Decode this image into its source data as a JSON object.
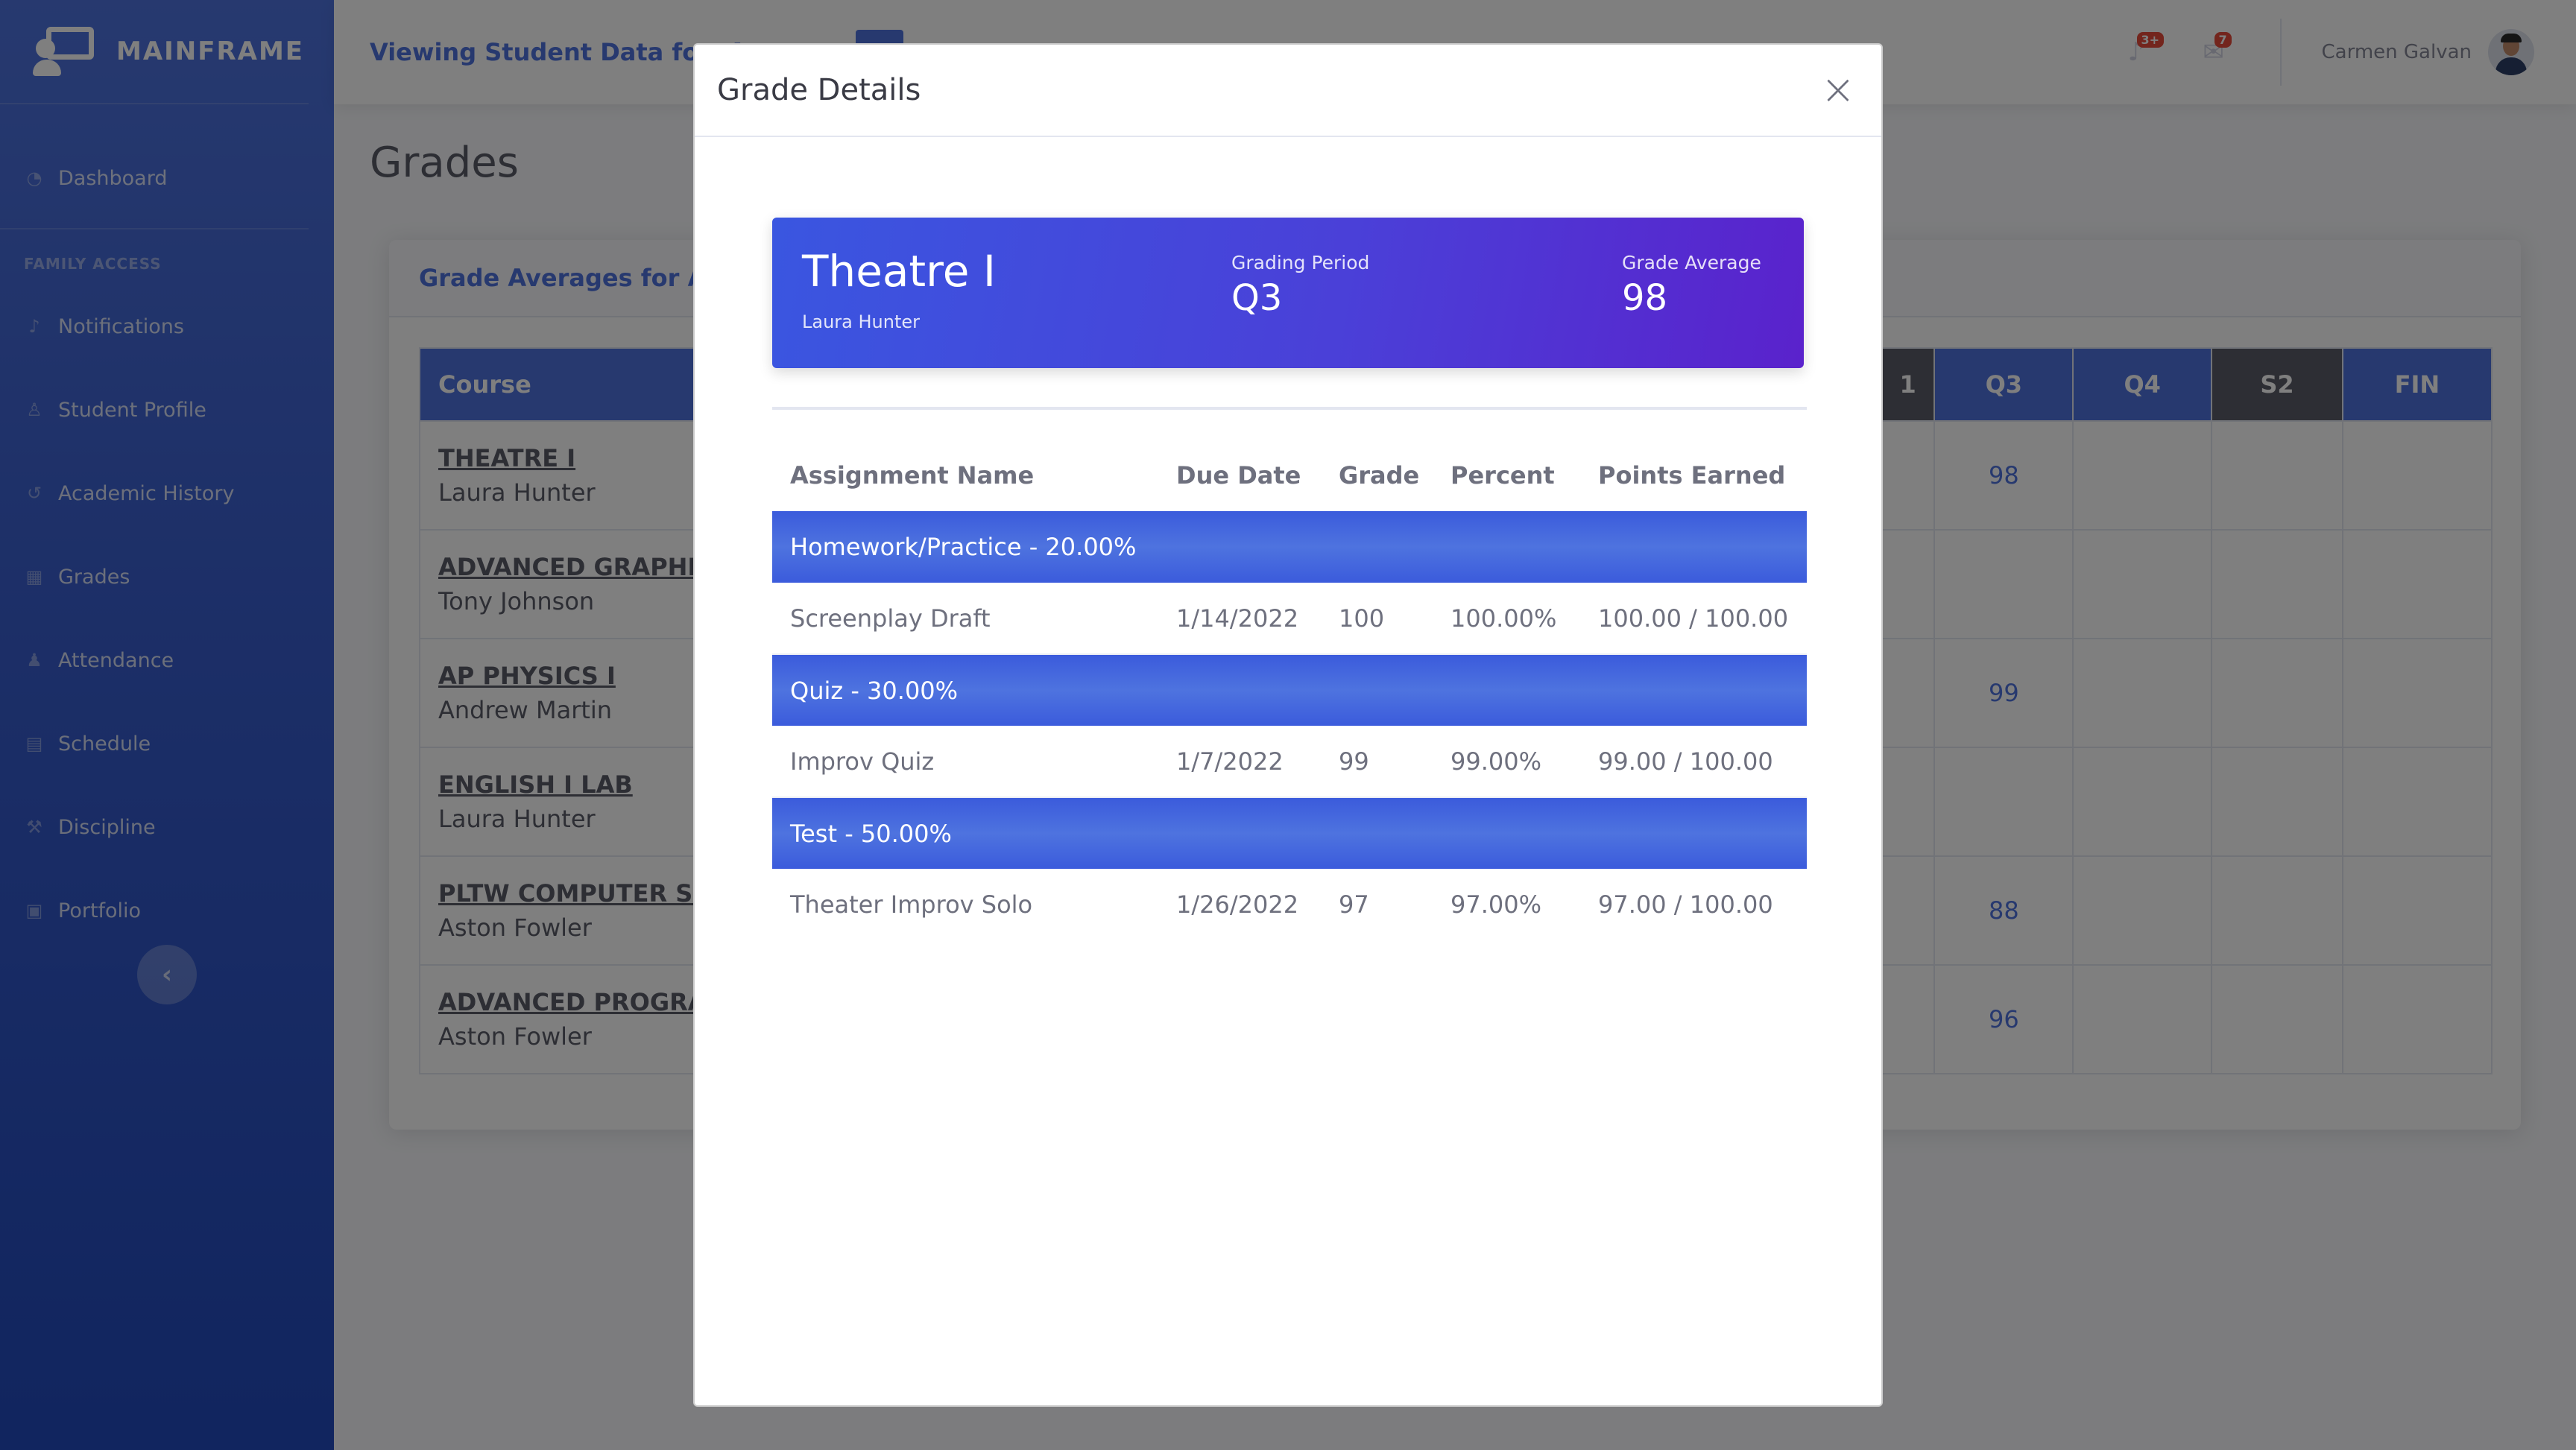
{
  "brand": {
    "name": "MAINFRAME"
  },
  "sidebar": {
    "dashboard": "Dashboard",
    "section": "FAMILY ACCESS",
    "items": [
      {
        "label": "Notifications",
        "icon": "bell-icon"
      },
      {
        "label": "Student Profile",
        "icon": "user-icon"
      },
      {
        "label": "Academic History",
        "icon": "history-icon"
      },
      {
        "label": "Grades",
        "icon": "table-icon"
      },
      {
        "label": "Attendance",
        "icon": "users-icon"
      },
      {
        "label": "Schedule",
        "icon": "calendar-icon"
      },
      {
        "label": "Discipline",
        "icon": "gavel-icon"
      },
      {
        "label": "Portfolio",
        "icon": "briefcase-icon"
      }
    ],
    "collapse_glyph": "‹"
  },
  "topbar": {
    "viewing": "Viewing Student Data for: An",
    "alerts_badge": "3+",
    "messages_badge": "7",
    "user_name": "Carmen Galvan"
  },
  "page": {
    "title": "Grades",
    "card_title": "Grade Averages for Andr",
    "columns": {
      "course": "Course",
      "c1": "1",
      "q3": "Q3",
      "q4": "Q4",
      "s2": "S2",
      "fin": "FIN"
    },
    "rows": [
      {
        "course": "THEATRE I",
        "teacher": "Laura Hunter",
        "q3": "98"
      },
      {
        "course": "ADVANCED GRAPHIC",
        "teacher": "Tony Johnson",
        "q3": ""
      },
      {
        "course": "AP PHYSICS I",
        "teacher": "Andrew Martin",
        "q3": "99"
      },
      {
        "course": "ENGLISH I LAB",
        "teacher": "Laura Hunter",
        "q3": ""
      },
      {
        "course": "PLTW COMPUTER SCI",
        "teacher": "Aston Fowler",
        "q3": "88"
      },
      {
        "course": "ADVANCED PROGRAM",
        "teacher": "Aston Fowler",
        "q3": "96"
      }
    ]
  },
  "modal": {
    "title": "Grade Details",
    "close": "×",
    "course": "Theatre I",
    "teacher": "Laura Hunter",
    "grading_period_label": "Grading Period",
    "grading_period": "Q3",
    "grade_average_label": "Grade Average",
    "grade_average": "98",
    "headers": {
      "name": "Assignment Name",
      "due": "Due Date",
      "grade": "Grade",
      "percent": "Percent",
      "points": "Points Earned"
    },
    "categories": [
      {
        "label": "Homework/Practice - 20.00%",
        "assignment": {
          "name": "Screenplay Draft",
          "due": "1/14/2022",
          "grade": "100",
          "percent": "100.00%",
          "points": "100.00 / 100.00"
        }
      },
      {
        "label": "Quiz - 30.00%",
        "assignment": {
          "name": "Improv Quiz",
          "due": "1/7/2022",
          "grade": "99",
          "percent": "99.00%",
          "points": "99.00 / 100.00"
        }
      },
      {
        "label": "Test - 50.00%",
        "assignment": {
          "name": "Theater Improv Solo",
          "due": "1/26/2022",
          "grade": "97",
          "percent": "97.00%",
          "points": "97.00 / 100.00"
        }
      }
    ]
  },
  "colors": {
    "primary": "#4e73df",
    "dark_header": "#5a5c69",
    "badge": "#e74a3b"
  }
}
